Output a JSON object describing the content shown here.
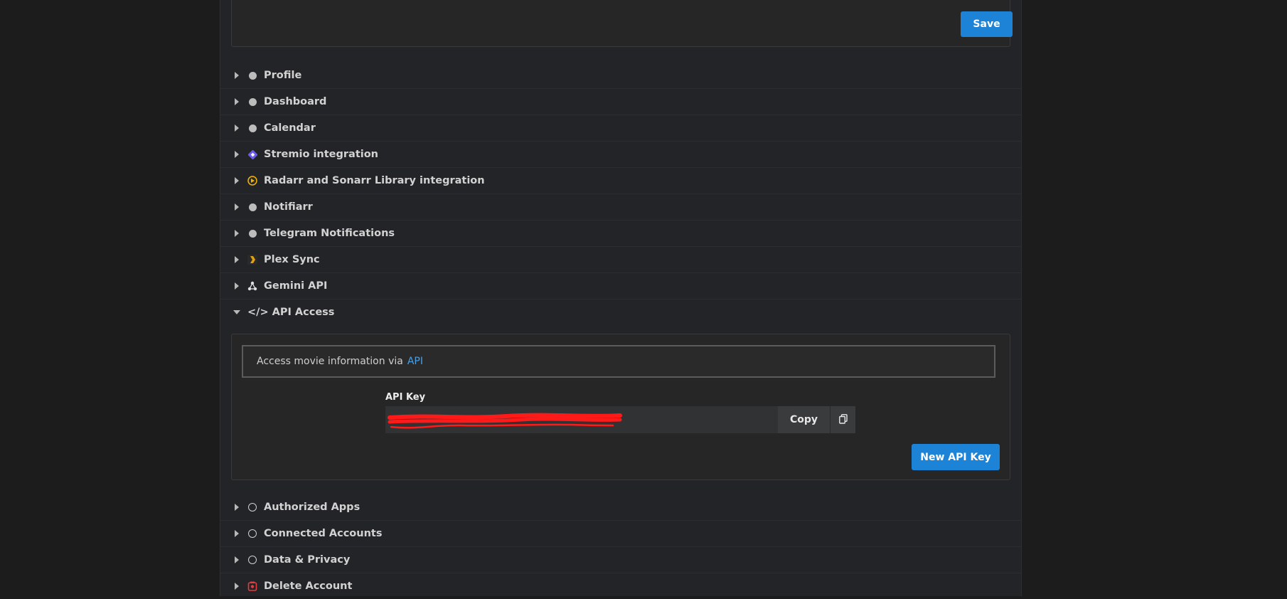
{
  "top": {
    "save_label": "Save"
  },
  "sections_before": [
    {
      "label": "Profile",
      "icon": "circle-filled-icon"
    },
    {
      "label": "Dashboard",
      "icon": "circle-filled-icon"
    },
    {
      "label": "Calendar",
      "icon": "circle-filled-icon"
    },
    {
      "label": "Stremio integration",
      "icon": "stremio-icon"
    },
    {
      "label": "Radarr and Sonarr Library integration",
      "icon": "radarr-icon"
    },
    {
      "label": "Notifiarr",
      "icon": "circle-filled-icon"
    },
    {
      "label": "Telegram Notifications",
      "icon": "circle-filled-icon"
    },
    {
      "label": "Plex Sync",
      "icon": "plex-icon"
    },
    {
      "label": "Gemini API",
      "icon": "gemini-icon"
    }
  ],
  "api_access": {
    "title": "</> API Access",
    "info_text": "Access movie information via",
    "info_link": "API",
    "key_label": "API Key",
    "copy_label": "Copy",
    "new_key_label": "New API Key"
  },
  "sections_after": [
    {
      "label": "Authorized Apps",
      "icon": "circle-outline-icon"
    },
    {
      "label": "Connected Accounts",
      "icon": "circle-outline-icon"
    },
    {
      "label": "Data & Privacy",
      "icon": "circle-outline-icon"
    },
    {
      "label": "Delete Account",
      "icon": "delete-icon"
    }
  ],
  "colors": {
    "accent": "#1c83d6",
    "link": "#4aa0e6",
    "redaction": "#ff1a1a"
  }
}
